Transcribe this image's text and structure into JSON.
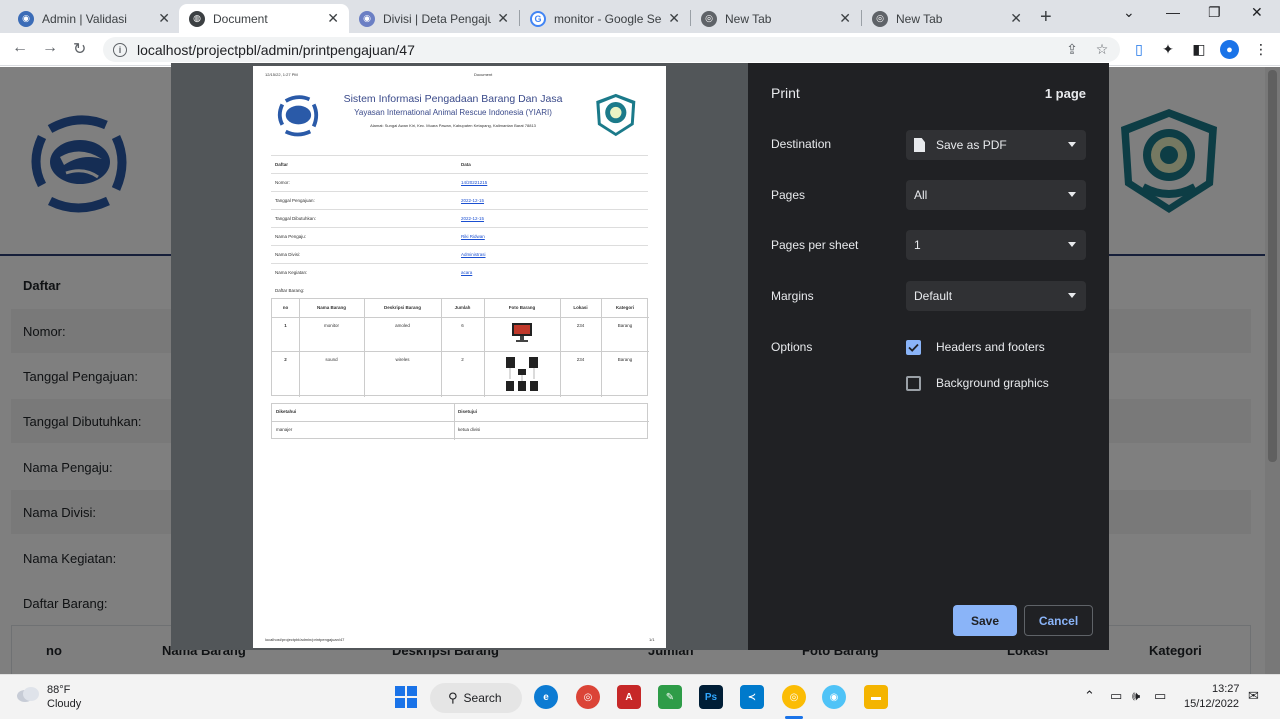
{
  "browser": {
    "tabs": [
      {
        "label": "Admin | Validasi",
        "icon": "admin-favicon-icon",
        "active": false
      },
      {
        "label": "Document",
        "icon": "globe-icon",
        "active": true
      },
      {
        "label": "Divisi | Deta Pengajua",
        "icon": "divisi-favicon-icon",
        "active": false
      },
      {
        "label": "monitor - Google Sea",
        "icon": "google-icon",
        "active": false
      },
      {
        "label": "New Tab",
        "icon": "chrome-icon",
        "active": false
      },
      {
        "label": "New Tab",
        "icon": "chrome-icon",
        "active": false
      }
    ],
    "url": "localhost/projectpbl/admin/printpengajuan/47"
  },
  "page": {
    "rows": [
      {
        "label": "Daftar",
        "bold": true
      },
      {
        "label": "Nomor:"
      },
      {
        "label": "Tanggal Pengajuan:"
      },
      {
        "label": "Tanggal Dibutuhkan:"
      },
      {
        "label": "Nama Pengaju:"
      },
      {
        "label": "Nama Divisi:"
      },
      {
        "label": "Nama Kegiatan:"
      },
      {
        "label": "Daftar Barang:"
      }
    ],
    "table_headers": [
      "no",
      "Nama Barang",
      "Deskripsi Barang",
      "Jumlah",
      "Foto Barang",
      "Lokasi",
      "Kategori"
    ]
  },
  "preview": {
    "header_left": "12/15/22, 1:27 PM",
    "header_center": "Document",
    "title": "Sistem Informasi Pengadaan Barang Dan Jasa",
    "subtitle": "Yayasan International Animal Rescue Indonesia (YIARI)",
    "address": "Alamat: Sungai Awan Kiri, Kec. Muara Pawan, Kabupaten Ketapang, Kalimantan Barat 78813",
    "info_header": {
      "k": "Daftar",
      "v": "Data"
    },
    "info_rows": [
      {
        "k": "Nomor:",
        "v": "14/20221215"
      },
      {
        "k": "Tanggal Pengajuan:",
        "v": "2022-12-15"
      },
      {
        "k": "Tanggal Dibutuhkan:",
        "v": "2022-12-15"
      },
      {
        "k": "Nama Pengaju:",
        "v": "Riki Ridwan"
      },
      {
        "k": "Nama Divisi:",
        "v": "Administrasi"
      },
      {
        "k": "Nama Kegiatan:",
        "v": "acara"
      }
    ],
    "list_label": "Daftar Barang:",
    "item_headers": [
      "no",
      "Nama Barang",
      "Deskripsi Barang",
      "Jumlah",
      "Foto Barang",
      "Lokasi",
      "Kategori"
    ],
    "items": [
      {
        "no": "1",
        "nama": "monitor",
        "desc": "amoled",
        "jumlah": "6",
        "lokasi": "234",
        "kategori": "Barang"
      },
      {
        "no": "2",
        "nama": "sound",
        "desc": "wireles",
        "jumlah": "2",
        "lokasi": "234",
        "kategori": "Barang"
      }
    ],
    "sign_headers": [
      "Diketahui",
      "Disetujui"
    ],
    "sign_values": [
      "manajer",
      "ketua divisi"
    ],
    "footer_left": "localhost/projectpbl/admin/printpengajuan/47",
    "footer_right": "1/1"
  },
  "print_dialog": {
    "title": "Print",
    "page_count": "1 page",
    "destination_label": "Destination",
    "destination_value": "Save as PDF",
    "pages_label": "Pages",
    "pages_value": "All",
    "pps_label": "Pages per sheet",
    "pps_value": "1",
    "margins_label": "Margins",
    "margins_value": "Default",
    "options_label": "Options",
    "headers_footers_label": "Headers and footers",
    "headers_footers_checked": true,
    "bg_graphics_label": "Background graphics",
    "bg_graphics_checked": false,
    "save_label": "Save",
    "cancel_label": "Cancel",
    "accent": "#8ab4f8"
  },
  "taskbar": {
    "weather_temp": "88°F",
    "weather_desc": "Cloudy",
    "search_label": "Search",
    "time": "13:27",
    "date": "15/12/2022"
  }
}
